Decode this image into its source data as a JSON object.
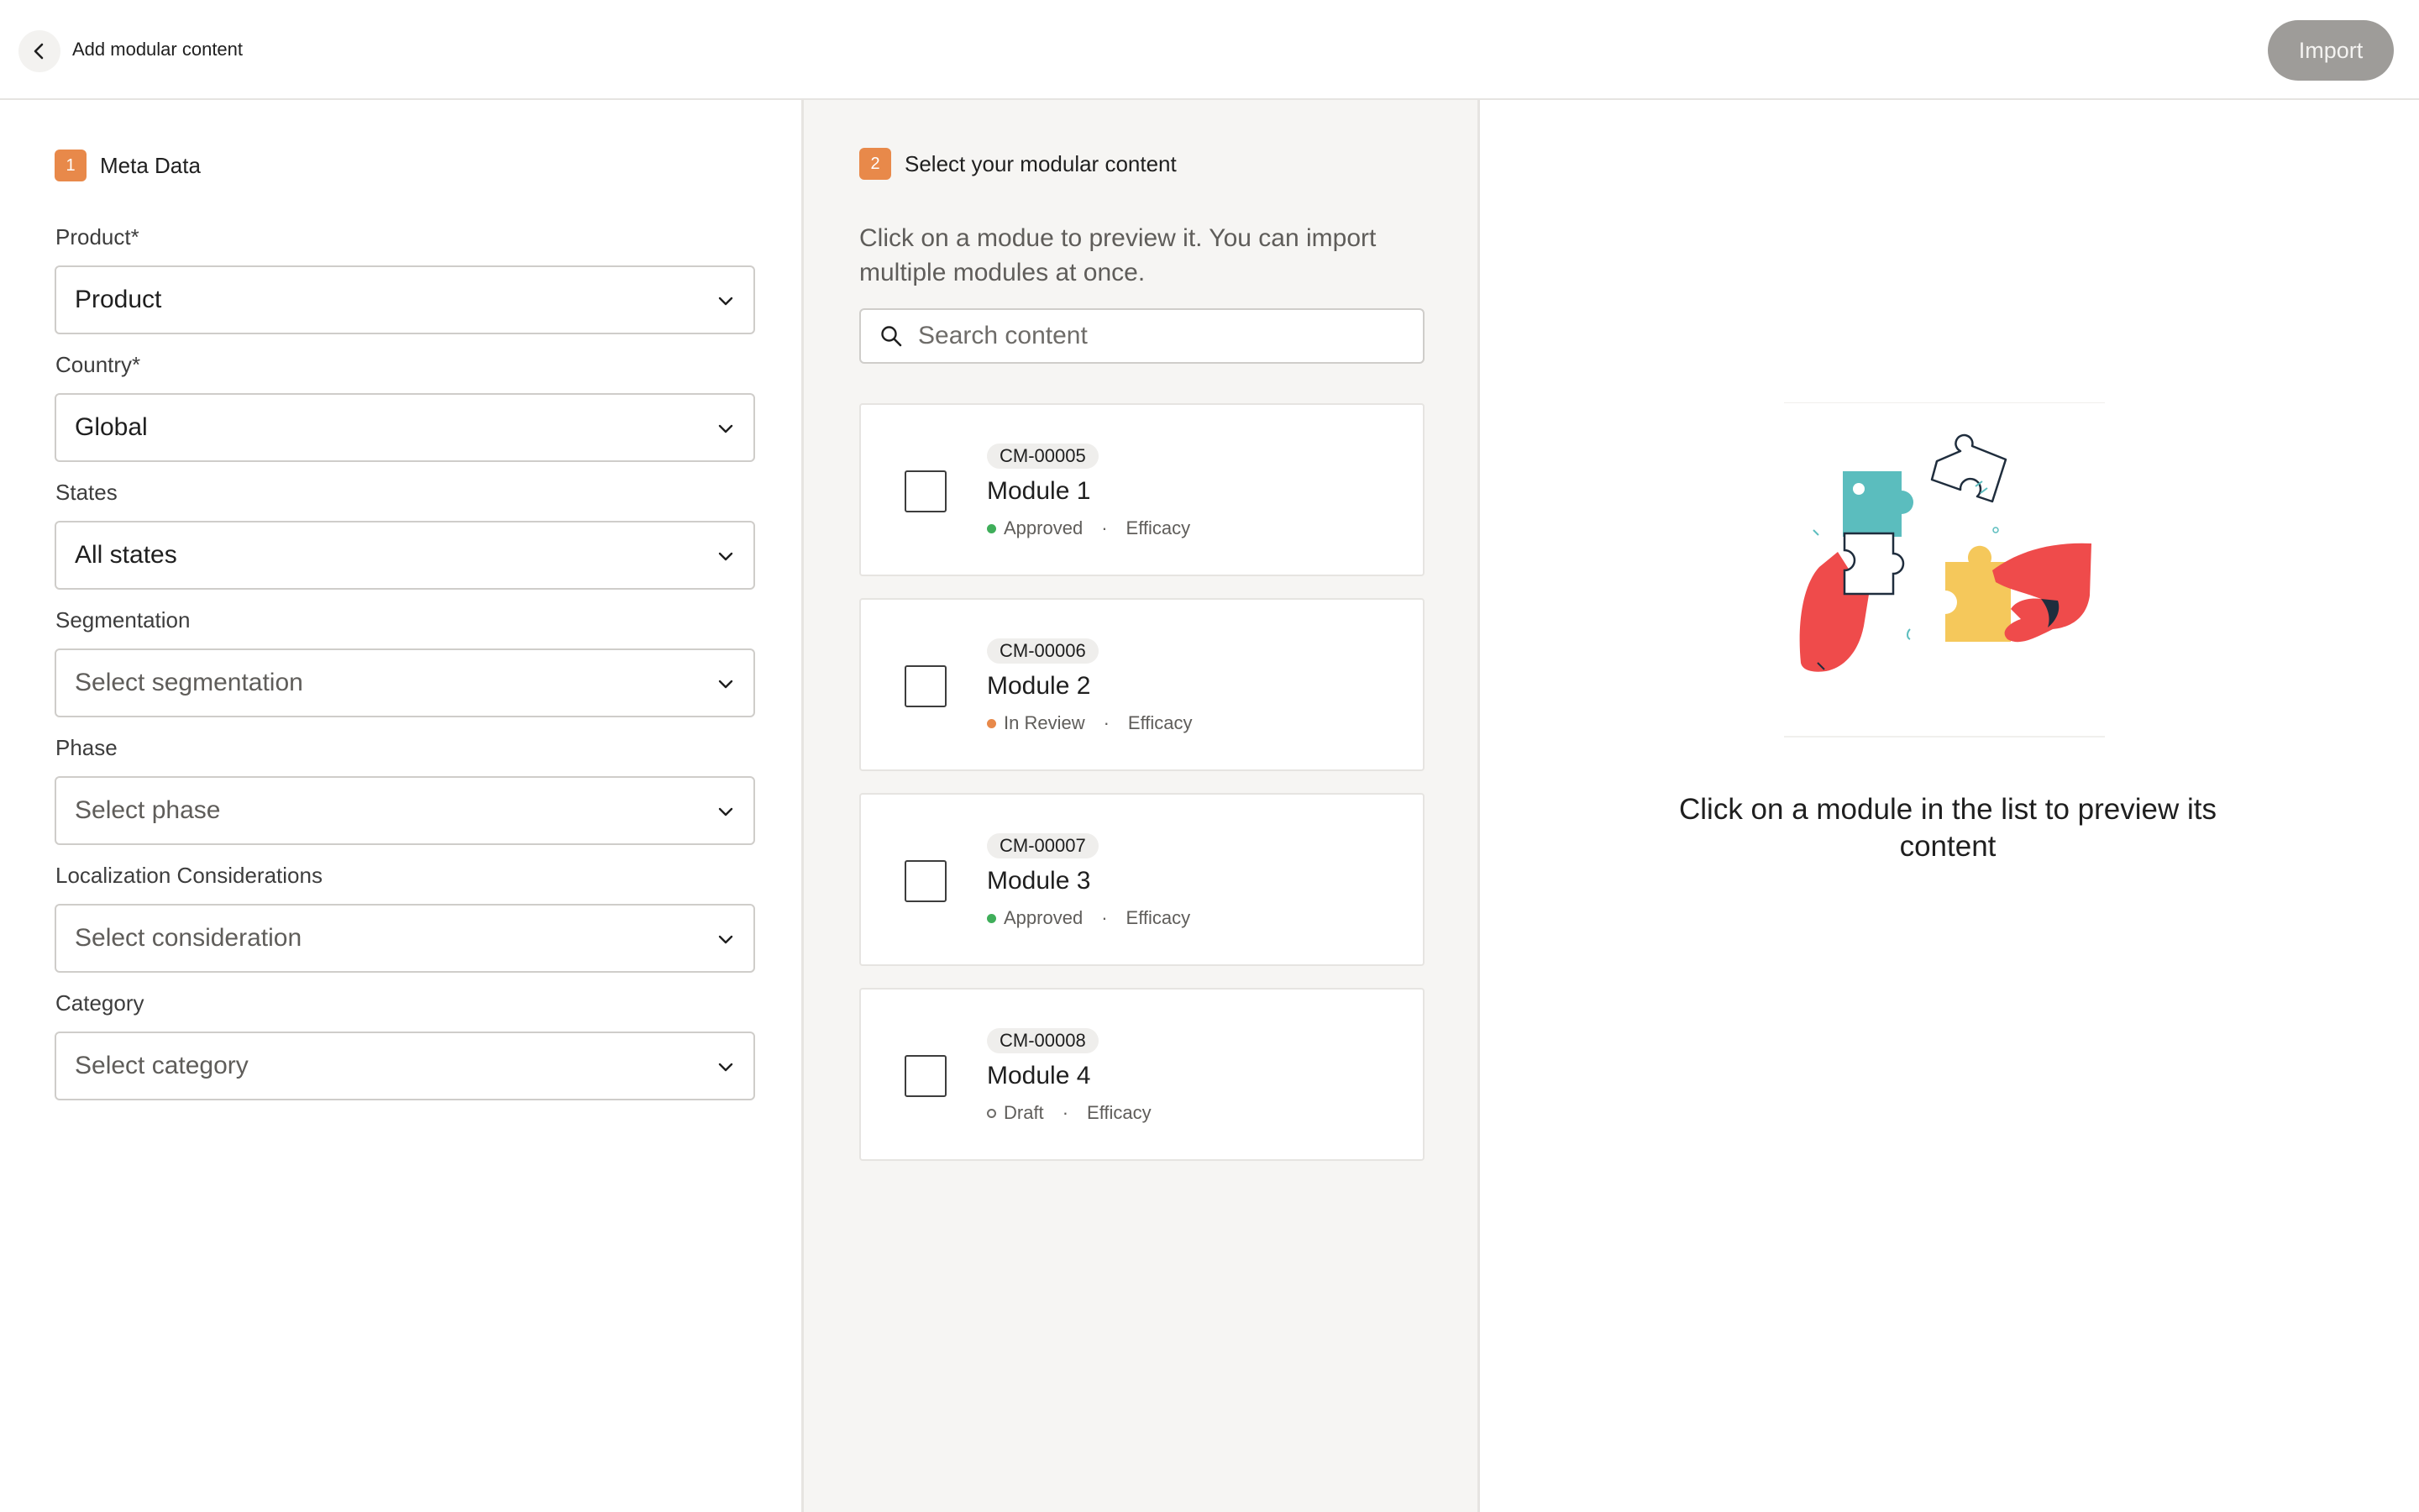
{
  "header": {
    "title": "Add modular content",
    "import_label": "Import"
  },
  "meta": {
    "step_number": "1",
    "step_label": "Meta Data",
    "fields": [
      {
        "label": "Product*",
        "value": "Product",
        "placeholder": false
      },
      {
        "label": "Country*",
        "value": "Global",
        "placeholder": false
      },
      {
        "label": "States",
        "value": "All states",
        "placeholder": false
      },
      {
        "label": "Segmentation",
        "value": "Select segmentation",
        "placeholder": true
      },
      {
        "label": "Phase",
        "value": "Select phase",
        "placeholder": true
      },
      {
        "label": "Localization Considerations",
        "value": "Select consideration",
        "placeholder": true
      },
      {
        "label": "Category",
        "value": "Select category",
        "placeholder": true
      }
    ]
  },
  "select": {
    "step_number": "2",
    "step_label": "Select your modular content",
    "hint": "Click on a modue to preview it. You can import multiple modules at once.",
    "search_placeholder": "Search content",
    "modules": [
      {
        "code": "CM-00005",
        "name": "Module 1",
        "status": "Approved",
        "tag": "Efficacy"
      },
      {
        "code": "CM-00006",
        "name": "Module 2",
        "status": "In Review",
        "tag": "Efficacy"
      },
      {
        "code": "CM-00007",
        "name": "Module 3",
        "status": "Approved",
        "tag": "Efficacy"
      },
      {
        "code": "CM-00008",
        "name": "Module 4",
        "status": "Draft",
        "tag": "Efficacy"
      }
    ],
    "separator": "·"
  },
  "preview": {
    "empty_message": "Click on a module in the list to preview its content"
  },
  "colors": {
    "accent": "#e8894a",
    "approved": "#3fae5a",
    "in_review": "#e8894a",
    "draft": "#6e6c69",
    "import_disabled": "#9e9c99"
  }
}
